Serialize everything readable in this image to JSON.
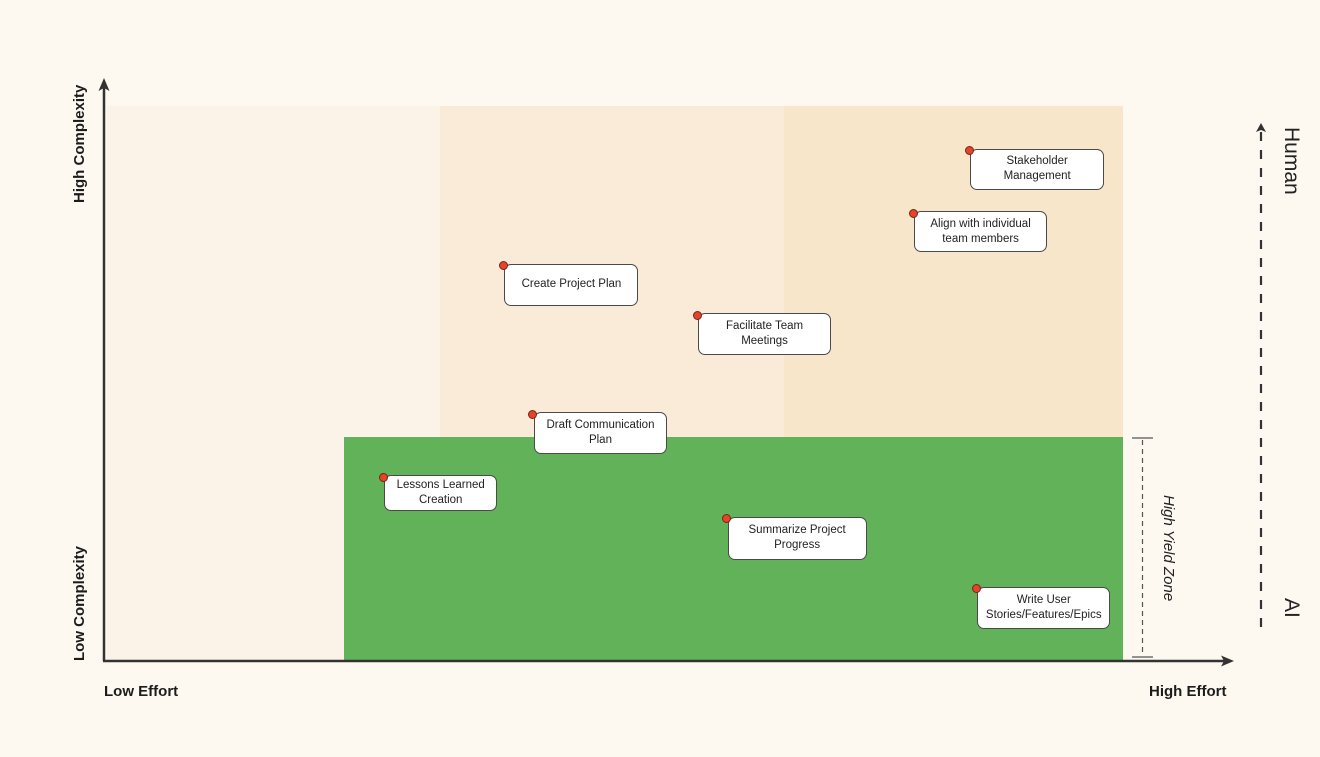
{
  "colors": {
    "background": "#fdf9f1",
    "zone_low": "#fbf3e7",
    "zone_mid": "#faebd8",
    "zone_high": "#f7e6c9",
    "high_yield": "#62b259",
    "axis": "#333333",
    "dot": "#e5432a"
  },
  "axes": {
    "x_low_label": "Low Effort",
    "x_high_label": "High Effort",
    "y_low_label": "Low Complexity",
    "y_high_label": "High Complexity"
  },
  "side_scale": {
    "top_label": "Human",
    "bottom_label": "AI"
  },
  "high_yield_zone": {
    "label": "High Yield Zone",
    "effort_range": [
      23.6,
      100
    ],
    "complexity_range": [
      0,
      40.4
    ]
  },
  "effort_bands": [
    {
      "name": "low",
      "effort_range": [
        0,
        33
      ]
    },
    {
      "name": "mid",
      "effort_range": [
        33,
        66.7
      ]
    },
    {
      "name": "high",
      "effort_range": [
        66.7,
        100
      ]
    }
  ],
  "chart_data": {
    "type": "scatter",
    "title": "",
    "xlabel": "Effort (Low → High)",
    "ylabel": "Complexity (Low → High)",
    "xlim": [
      0,
      100
    ],
    "ylim": [
      0,
      100
    ],
    "grid": false,
    "points": [
      {
        "label": "Stakeholder Management",
        "lines": [
          "Stakeholder",
          "Management"
        ],
        "effort": 84.9,
        "complexity": 91.9
      },
      {
        "label": "Align with individual team members",
        "lines": [
          "Align with individual",
          "team members"
        ],
        "effort": 79.4,
        "complexity": 80.7
      },
      {
        "label": "Create Project Plan",
        "lines": [
          "Create Project Plan"
        ],
        "effort": 39.2,
        "complexity": 71.2
      },
      {
        "label": "Facilitate Team Meetings",
        "lines": [
          "Facilitate Team",
          "Meetings"
        ],
        "effort": 58.2,
        "complexity": 62.3
      },
      {
        "label": "Draft Communication Plan",
        "lines": [
          "Draft Communication",
          "Plan"
        ],
        "effort": 42.1,
        "complexity": 44.5
      },
      {
        "label": "Lessons Learned Creation",
        "lines": [
          "Lessons Learned",
          "Creation"
        ],
        "effort": 27.4,
        "complexity": 33.1
      },
      {
        "label": "Summarize Project Progress",
        "lines": [
          "Summarize Project",
          "Progress"
        ],
        "effort": 61.1,
        "complexity": 25.6
      },
      {
        "label": "Write User Stories/Features/Epics",
        "lines": [
          "Write User",
          "Stories/Features/Epics"
        ],
        "effort": 85.6,
        "complexity": 13.0
      }
    ]
  }
}
